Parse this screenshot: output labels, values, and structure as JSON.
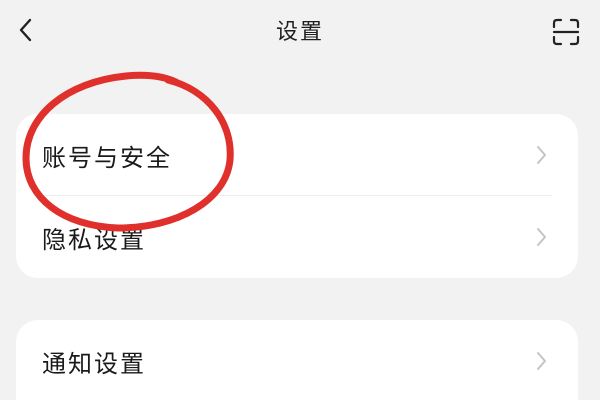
{
  "header": {
    "title": "设置"
  },
  "groups": [
    {
      "items": [
        {
          "label": "账号与安全"
        },
        {
          "label": "隐私设置"
        }
      ]
    },
    {
      "items": [
        {
          "label": "通知设置"
        }
      ]
    }
  ],
  "icons": {
    "back": "chevron-left-icon",
    "scan": "scan-icon",
    "row_arrow": "chevron-right-icon"
  },
  "colors": {
    "background": "#f2f2f2",
    "card": "#ffffff",
    "annotation": "#e0302c",
    "chevron": "#c4c4c4"
  }
}
